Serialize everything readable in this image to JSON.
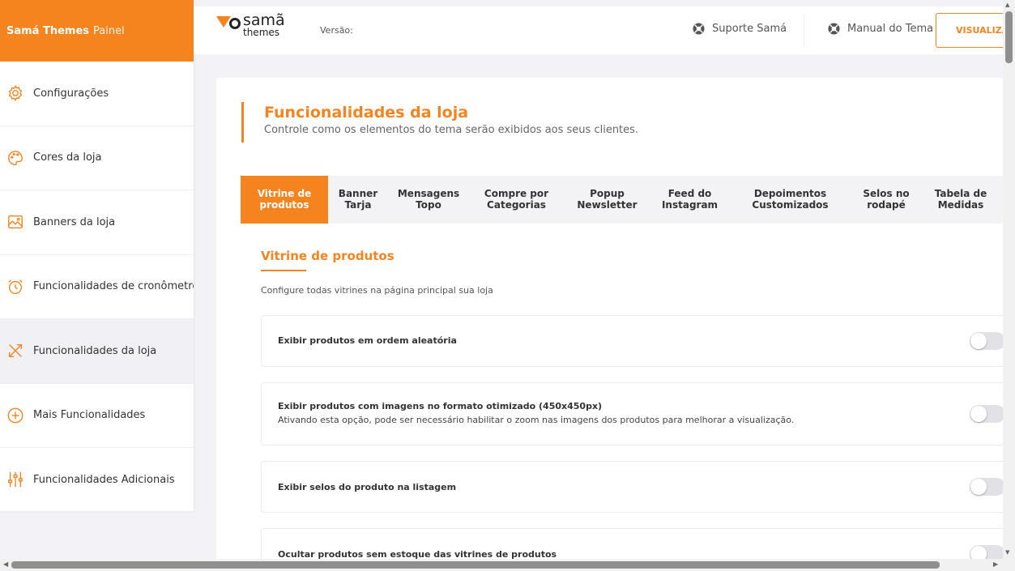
{
  "sidebar": {
    "brand_bold": "Samá Themes",
    "brand_light": "Painel",
    "items": [
      {
        "label": "Configurações",
        "icon": "gear-icon"
      },
      {
        "label": "Cores da loja",
        "icon": "palette-icon"
      },
      {
        "label": "Banners da loja",
        "icon": "image-icon"
      },
      {
        "label": "Funcionalidades de cronômetros",
        "icon": "alarm-clock-icon"
      },
      {
        "label": "Funcionalidades da loja",
        "icon": "tools-icon"
      },
      {
        "label": "Mais Funcionalidades",
        "icon": "plus-circle-icon"
      },
      {
        "label": "Funcionalidades Adicionais",
        "icon": "sliders-icon"
      }
    ]
  },
  "header": {
    "logo_top": "samã",
    "logo_bottom": "themes",
    "version_label": "Versão:",
    "support_label": "Suporte Samá",
    "manual_label": "Manual do Tema",
    "visualize_label": "VISUALIZAR"
  },
  "main": {
    "title": "Funcionalidades da loja",
    "subtitle": "Controle como os elementos do tema serão exibidos aos seus clientes.",
    "tabs": [
      {
        "line1": "Vitrine de",
        "line2": "produtos"
      },
      {
        "line1": "Banner",
        "line2": "Tarja"
      },
      {
        "line1": "Mensagens",
        "line2": "Topo"
      },
      {
        "line1": "Compre por",
        "line2": "Categorias"
      },
      {
        "line1": "Popup",
        "line2": "Newsletter"
      },
      {
        "line1": "Feed do",
        "line2": "Instagram"
      },
      {
        "line1": "Depoimentos",
        "line2": "Customizados"
      },
      {
        "line1": "Selos no",
        "line2": "rodapé"
      },
      {
        "line1": "Tabela de",
        "line2": "Medidas"
      }
    ],
    "section_title": "Vitrine de produtos",
    "section_desc": "Configure todas vitrines na página principal sua loja",
    "options": [
      {
        "label": "Exibir produtos em ordem aleatória",
        "sub": "",
        "enabled": false
      },
      {
        "label": "Exibir produtos com imagens no formato otimizado (450x450px)",
        "sub": "Ativando esta opção, pode ser necessário habilitar o zoom nas imagens dos produtos para melhorar a visualização.",
        "enabled": false
      },
      {
        "label": "Exibir selos do produto na listagem",
        "sub": "",
        "enabled": false
      },
      {
        "label": "Ocultar produtos sem estoque das vitrines de produtos",
        "sub": "",
        "enabled": false
      }
    ]
  },
  "colors": {
    "accent": "#f5841f",
    "background": "#f3f3f7"
  }
}
